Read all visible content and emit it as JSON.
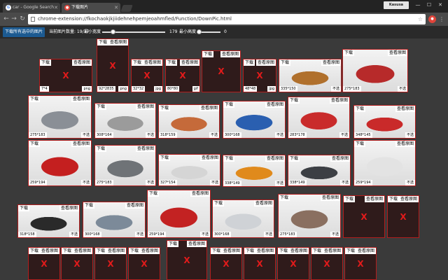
{
  "browser": {
    "tabs": [
      {
        "title": "car - Google Search",
        "favicon": "G"
      },
      {
        "title": "下载图片",
        "favicon": "●"
      }
    ],
    "user": "Kasusa",
    "window_controls": [
      "—",
      "☐",
      "✕"
    ],
    "url": "chrome-extension://fkochaokjkjiidehnehpemjeoahmfled/Function/DownPic.html"
  },
  "controls": {
    "download_all": "下载所有选中的图片",
    "count_label": "当前图片数量: 19/37",
    "min_width_label": "最小宽度",
    "min_width_value": "179",
    "min_height_label": "最小高度",
    "min_height_value": "0"
  },
  "labels": {
    "download": "下载",
    "view": "查看原图"
  },
  "images": [
    {
      "size": "7*4",
      "type": "png",
      "broken": true,
      "color": "#2f1b1b"
    },
    {
      "size": "92*2835",
      "type": "png",
      "broken": true,
      "color": "#2f1b1b"
    },
    {
      "size": "32*32",
      "type": "jpg",
      "broken": true,
      "color": "#2f1b1b"
    },
    {
      "size": "80*80",
      "type": "gif",
      "broken": true,
      "color": "#2f1b1b"
    },
    {
      "size": "",
      "type": "",
      "broken": true,
      "color": "#2f1b1b"
    },
    {
      "size": "48*48",
      "type": "jpg",
      "broken": true,
      "color": "#2f1b1b"
    },
    {
      "size": "335*150",
      "type": "不选",
      "broken": false,
      "color": "#b0702c"
    },
    {
      "size": "275*183",
      "type": "不选",
      "broken": false,
      "color": "#b72a2a"
    },
    {
      "size": "275*183",
      "type": "不选",
      "broken": false,
      "color": "#8a8f96"
    },
    {
      "size": "308*164",
      "type": "不选",
      "broken": false,
      "color": "#9b9b9b"
    },
    {
      "size": "318*159",
      "type": "不选",
      "broken": false,
      "color": "#c56a3a"
    },
    {
      "size": "300*168",
      "type": "不选",
      "broken": false,
      "color": "#2a5fb0"
    },
    {
      "size": "283*178",
      "type": "不选",
      "broken": false,
      "color": "#c92b2b"
    },
    {
      "size": "348*145",
      "type": "不选",
      "broken": false,
      "color": "#c92a2a"
    },
    {
      "size": "259*194",
      "type": "不选",
      "broken": false,
      "color": "#c41f1f"
    },
    {
      "size": "275*183",
      "type": "不选",
      "broken": false,
      "color": "#6f7377"
    },
    {
      "size": "327*154",
      "type": "不选",
      "broken": false,
      "color": "#d5d5d5"
    },
    {
      "size": "338*149",
      "type": "不选",
      "broken": false,
      "color": "#e08a1c"
    },
    {
      "size": "338*149",
      "type": "不选",
      "broken": false,
      "color": "#3c3f44"
    },
    {
      "size": "259*194",
      "type": "不选",
      "broken": false,
      "color": "#e3e3e3"
    },
    {
      "size": "318*158",
      "type": "不选",
      "broken": false,
      "color": "#2a2a2a"
    },
    {
      "size": "300*168",
      "type": "不选",
      "broken": false,
      "color": "#7c8a99"
    },
    {
      "size": "259*194",
      "type": "不选",
      "broken": false,
      "color": "#c32222"
    },
    {
      "size": "300*168",
      "type": "不选",
      "broken": false,
      "color": "#cfd2d6"
    },
    {
      "size": "275*183",
      "type": "不选",
      "broken": false,
      "color": "#8a6f60"
    },
    {
      "size": "",
      "type": "",
      "broken": true,
      "color": "#2f1b1b"
    },
    {
      "size": "",
      "type": "",
      "broken": true,
      "color": "#2f1b1b"
    },
    {
      "size": "",
      "type": "",
      "broken": true,
      "color": "#2f1b1b"
    },
    {
      "size": "",
      "type": "",
      "broken": true,
      "color": "#2f1b1b"
    },
    {
      "size": "",
      "type": "",
      "broken": true,
      "color": "#2f1b1b"
    },
    {
      "size": "",
      "type": "",
      "broken": true,
      "color": "#2f1b1b"
    },
    {
      "size": "",
      "type": "",
      "broken": true,
      "color": "#2f1b1b"
    },
    {
      "size": "",
      "type": "",
      "broken": true,
      "color": "#2f1b1b"
    },
    {
      "size": "",
      "type": "",
      "broken": true,
      "color": "#2f1b1b"
    },
    {
      "size": "",
      "type": "",
      "broken": true,
      "color": "#2f1b1b"
    },
    {
      "size": "",
      "type": "",
      "broken": true,
      "color": "#2f1b1b"
    },
    {
      "size": "",
      "type": "",
      "broken": true,
      "color": "#2f1b1b"
    }
  ]
}
